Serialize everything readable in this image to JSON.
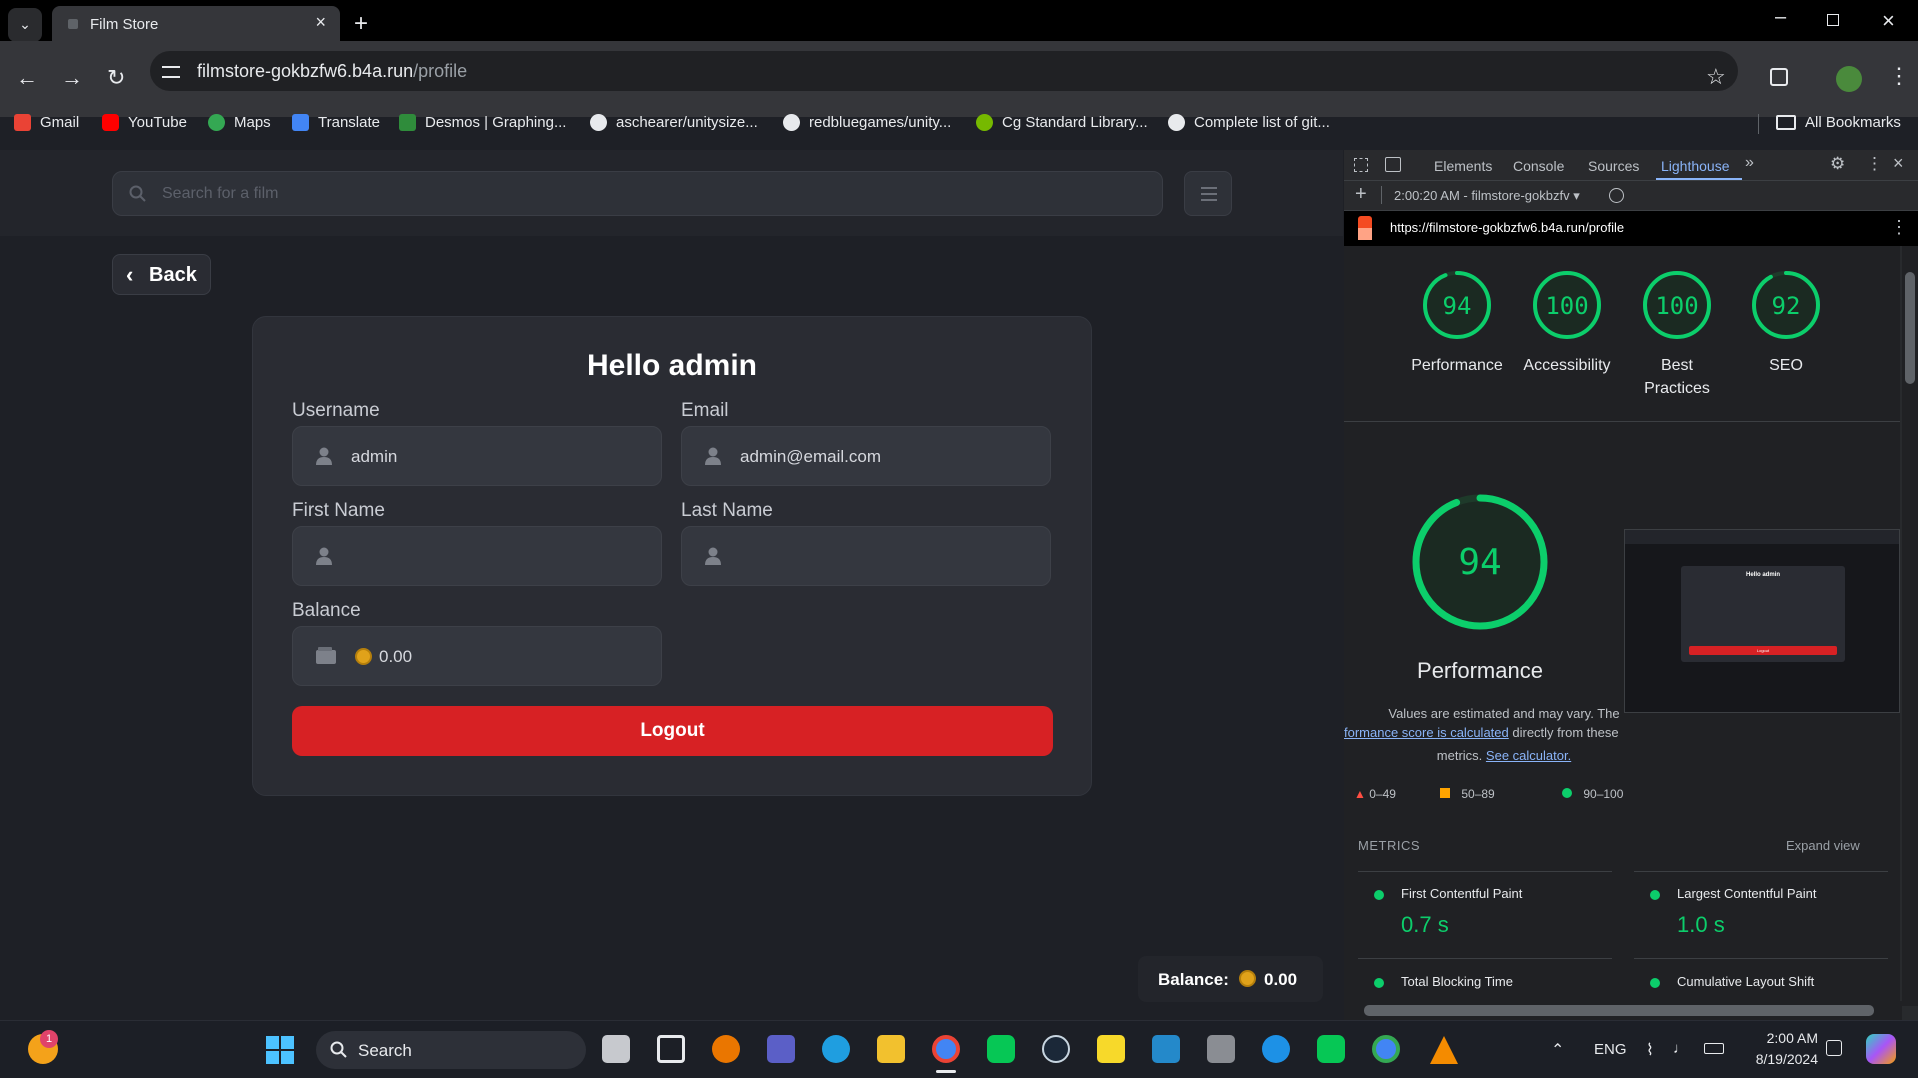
{
  "browser": {
    "tab_title": "Film Store",
    "url_host": "filmstore-gokbzfw6.b4a.run",
    "url_path": "/profile",
    "bookmarks": [
      "Gmail",
      "YouTube",
      "Maps",
      "Translate",
      "Desmos | Graphing...",
      "aschearer/unitysize...",
      "redbluegames/unity...",
      "Cg Standard Library...",
      "Complete list of git..."
    ],
    "all_bookmarks": "All Bookmarks"
  },
  "page": {
    "search_placeholder": "Search for a film",
    "back_label": "Back",
    "heading": "Hello admin",
    "username_label": "Username",
    "username_value": "admin",
    "email_label": "Email",
    "email_value": "admin@email.com",
    "first_name_label": "First Name",
    "first_name_value": "",
    "last_name_label": "Last Name",
    "last_name_value": "",
    "balance_label": "Balance",
    "balance_value": "0.00",
    "logout_label": "Logout",
    "footer_balance_label": "Balance:",
    "footer_balance_value": "0.00"
  },
  "devtools": {
    "tabs": [
      "Elements",
      "Console",
      "Sources",
      "Lighthouse"
    ],
    "active_tab": "Lighthouse",
    "report_time": "2:00:20 AM - filmstore-gokbzfv",
    "report_url": "https://filmstore-gokbzfw6.b4a.run/profile",
    "scores": [
      {
        "label": "Performance",
        "value": "94"
      },
      {
        "label": "Accessibility",
        "value": "100"
      },
      {
        "label": "Best Practices",
        "value": "100"
      },
      {
        "label": "SEO",
        "value": "92"
      }
    ],
    "main_score": "94",
    "main_label": "Performance",
    "note_line1": "Values are estimated and may vary. The",
    "note_link": "formance score is calculated",
    "note_line2_rest": "directly from these",
    "note_line3": "metrics.",
    "note_calc_link": "See calculator.",
    "legend": [
      "0–49",
      "50–89",
      "90–100"
    ],
    "metrics_title": "METRICS",
    "expand_view": "Expand view",
    "metrics": [
      {
        "name": "First Contentful Paint",
        "value": "0.7 s"
      },
      {
        "name": "Largest Contentful Paint",
        "value": "1.0 s"
      },
      {
        "name": "Total Blocking Time",
        "value": ""
      },
      {
        "name": "Cumulative Layout Shift",
        "value": ""
      }
    ],
    "thumb_heading": "Hello admin",
    "thumb_logout": "Logout"
  },
  "taskbar": {
    "search_label": "Search",
    "notification_count": "1",
    "language": "ENG",
    "time": "2:00 AM",
    "date": "8/19/2024"
  },
  "colors": {
    "score_green": "#0cce6b",
    "logout_red": "#d72124",
    "link_blue": "#8ab4f8"
  }
}
